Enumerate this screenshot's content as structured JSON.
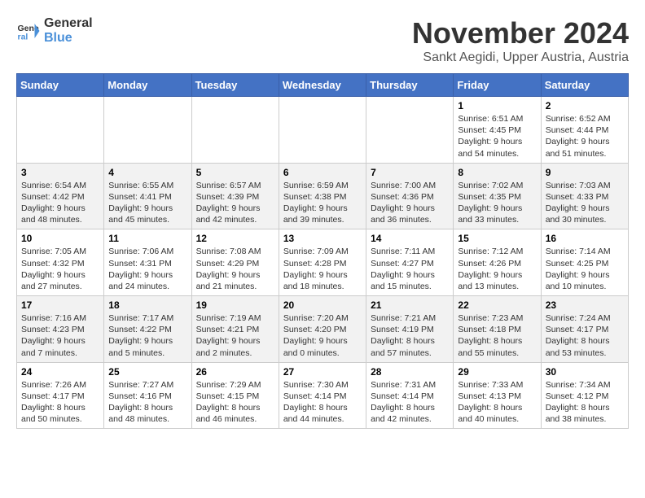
{
  "header": {
    "logo_line1": "General",
    "logo_line2": "Blue",
    "month_year": "November 2024",
    "location": "Sankt Aegidi, Upper Austria, Austria"
  },
  "weekdays": [
    "Sunday",
    "Monday",
    "Tuesday",
    "Wednesday",
    "Thursday",
    "Friday",
    "Saturday"
  ],
  "weeks": [
    [
      {
        "day": "",
        "info": ""
      },
      {
        "day": "",
        "info": ""
      },
      {
        "day": "",
        "info": ""
      },
      {
        "day": "",
        "info": ""
      },
      {
        "day": "",
        "info": ""
      },
      {
        "day": "1",
        "info": "Sunrise: 6:51 AM\nSunset: 4:45 PM\nDaylight: 9 hours\nand 54 minutes."
      },
      {
        "day": "2",
        "info": "Sunrise: 6:52 AM\nSunset: 4:44 PM\nDaylight: 9 hours\nand 51 minutes."
      }
    ],
    [
      {
        "day": "3",
        "info": "Sunrise: 6:54 AM\nSunset: 4:42 PM\nDaylight: 9 hours\nand 48 minutes."
      },
      {
        "day": "4",
        "info": "Sunrise: 6:55 AM\nSunset: 4:41 PM\nDaylight: 9 hours\nand 45 minutes."
      },
      {
        "day": "5",
        "info": "Sunrise: 6:57 AM\nSunset: 4:39 PM\nDaylight: 9 hours\nand 42 minutes."
      },
      {
        "day": "6",
        "info": "Sunrise: 6:59 AM\nSunset: 4:38 PM\nDaylight: 9 hours\nand 39 minutes."
      },
      {
        "day": "7",
        "info": "Sunrise: 7:00 AM\nSunset: 4:36 PM\nDaylight: 9 hours\nand 36 minutes."
      },
      {
        "day": "8",
        "info": "Sunrise: 7:02 AM\nSunset: 4:35 PM\nDaylight: 9 hours\nand 33 minutes."
      },
      {
        "day": "9",
        "info": "Sunrise: 7:03 AM\nSunset: 4:33 PM\nDaylight: 9 hours\nand 30 minutes."
      }
    ],
    [
      {
        "day": "10",
        "info": "Sunrise: 7:05 AM\nSunset: 4:32 PM\nDaylight: 9 hours\nand 27 minutes."
      },
      {
        "day": "11",
        "info": "Sunrise: 7:06 AM\nSunset: 4:31 PM\nDaylight: 9 hours\nand 24 minutes."
      },
      {
        "day": "12",
        "info": "Sunrise: 7:08 AM\nSunset: 4:29 PM\nDaylight: 9 hours\nand 21 minutes."
      },
      {
        "day": "13",
        "info": "Sunrise: 7:09 AM\nSunset: 4:28 PM\nDaylight: 9 hours\nand 18 minutes."
      },
      {
        "day": "14",
        "info": "Sunrise: 7:11 AM\nSunset: 4:27 PM\nDaylight: 9 hours\nand 15 minutes."
      },
      {
        "day": "15",
        "info": "Sunrise: 7:12 AM\nSunset: 4:26 PM\nDaylight: 9 hours\nand 13 minutes."
      },
      {
        "day": "16",
        "info": "Sunrise: 7:14 AM\nSunset: 4:25 PM\nDaylight: 9 hours\nand 10 minutes."
      }
    ],
    [
      {
        "day": "17",
        "info": "Sunrise: 7:16 AM\nSunset: 4:23 PM\nDaylight: 9 hours\nand 7 minutes."
      },
      {
        "day": "18",
        "info": "Sunrise: 7:17 AM\nSunset: 4:22 PM\nDaylight: 9 hours\nand 5 minutes."
      },
      {
        "day": "19",
        "info": "Sunrise: 7:19 AM\nSunset: 4:21 PM\nDaylight: 9 hours\nand 2 minutes."
      },
      {
        "day": "20",
        "info": "Sunrise: 7:20 AM\nSunset: 4:20 PM\nDaylight: 9 hours\nand 0 minutes."
      },
      {
        "day": "21",
        "info": "Sunrise: 7:21 AM\nSunset: 4:19 PM\nDaylight: 8 hours\nand 57 minutes."
      },
      {
        "day": "22",
        "info": "Sunrise: 7:23 AM\nSunset: 4:18 PM\nDaylight: 8 hours\nand 55 minutes."
      },
      {
        "day": "23",
        "info": "Sunrise: 7:24 AM\nSunset: 4:17 PM\nDaylight: 8 hours\nand 53 minutes."
      }
    ],
    [
      {
        "day": "24",
        "info": "Sunrise: 7:26 AM\nSunset: 4:17 PM\nDaylight: 8 hours\nand 50 minutes."
      },
      {
        "day": "25",
        "info": "Sunrise: 7:27 AM\nSunset: 4:16 PM\nDaylight: 8 hours\nand 48 minutes."
      },
      {
        "day": "26",
        "info": "Sunrise: 7:29 AM\nSunset: 4:15 PM\nDaylight: 8 hours\nand 46 minutes."
      },
      {
        "day": "27",
        "info": "Sunrise: 7:30 AM\nSunset: 4:14 PM\nDaylight: 8 hours\nand 44 minutes."
      },
      {
        "day": "28",
        "info": "Sunrise: 7:31 AM\nSunset: 4:14 PM\nDaylight: 8 hours\nand 42 minutes."
      },
      {
        "day": "29",
        "info": "Sunrise: 7:33 AM\nSunset: 4:13 PM\nDaylight: 8 hours\nand 40 minutes."
      },
      {
        "day": "30",
        "info": "Sunrise: 7:34 AM\nSunset: 4:12 PM\nDaylight: 8 hours\nand 38 minutes."
      }
    ]
  ]
}
